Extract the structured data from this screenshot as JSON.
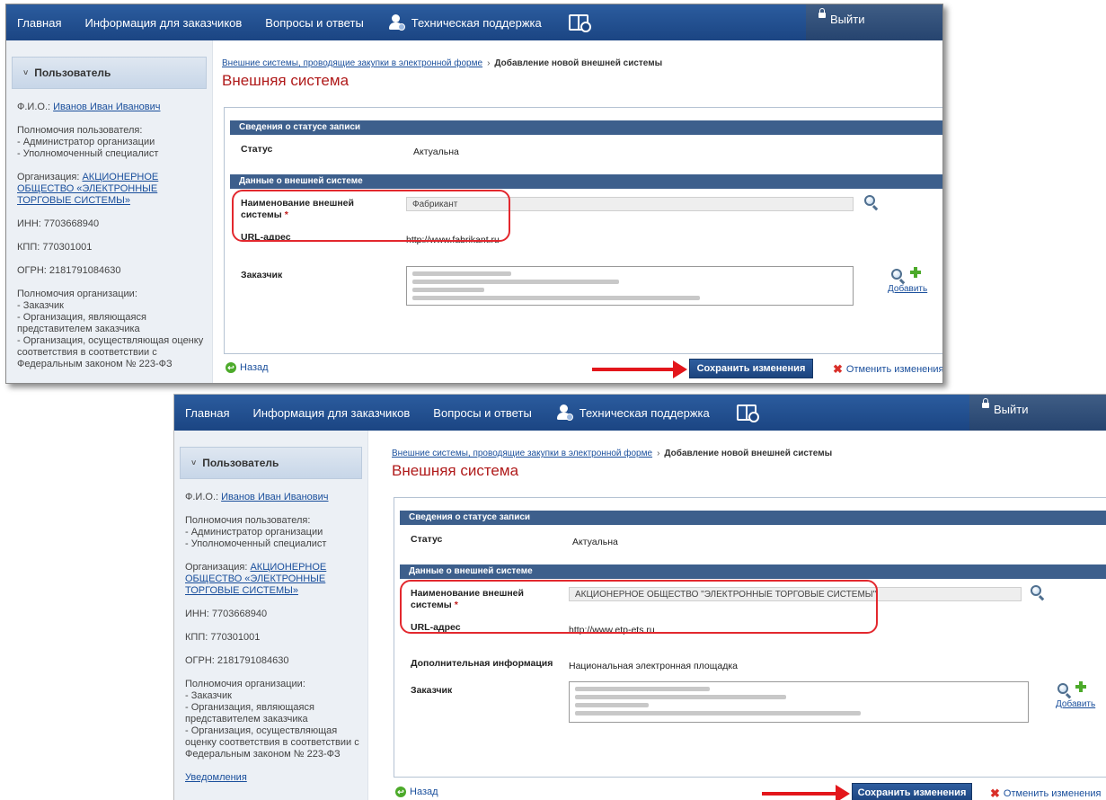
{
  "nav": {
    "home": "Главная",
    "customers_info": "Информация для заказчиков",
    "faq": "Вопросы и ответы",
    "support": "Техническая поддержка",
    "logout": "Выйти"
  },
  "sidebar": {
    "header": "Пользователь",
    "fio_label": "Ф.И.О.:",
    "fio_value": "Иванов Иван Иванович",
    "user_powers_label": "Полномочия пользователя:",
    "user_powers": [
      "- Администратор организации",
      "- Уполномоченный специалист"
    ],
    "org_label": "Организация:",
    "org_value": "АКЦИОНЕРНОЕ ОБЩЕСТВО «ЭЛЕКТРОННЫЕ ТОРГОВЫЕ СИСТЕМЫ»",
    "inn": "ИНН: 7703668940",
    "kpp": "КПП: 770301001",
    "ogrn": "ОГРН: 2181791084630",
    "org_powers_label": "Полномочия организации:",
    "org_powers": [
      "- Заказчик",
      "- Организация, являющаяся представителем заказчика",
      "- Организация, осуществляющая оценку соответствия в соответствии с Федеральным законом № 223-ФЗ"
    ],
    "notifications": "Уведомления"
  },
  "breadcrumb": {
    "parent": "Внешние системы, проводящие закупки в электронной форме",
    "separator": "›",
    "current": "Добавление новой внешней системы"
  },
  "page_title": "Внешняя система",
  "sections": {
    "status": "Сведения о статусе записи",
    "external": "Данные о внешней системе"
  },
  "labels": {
    "status": "Статус",
    "name_line1": "Наименование внешней",
    "name_line2": "системы",
    "required": "*",
    "url": "URL-адрес",
    "additional": "Дополнительная информация",
    "customer": "Заказчик",
    "add": "Добавить"
  },
  "record1": {
    "status": "Актуальна",
    "name": "Фабрикант",
    "url": "http://www.fabrikant.ru"
  },
  "record2": {
    "status": "Актуальна",
    "name": "АКЦИОНЕРНОЕ ОБЩЕСТВО \"ЭЛЕКТРОННЫЕ ТОРГОВЫЕ СИСТЕМЫ\"",
    "url": "http://www.etp-ets.ru",
    "additional": "Национальная электронная площадка"
  },
  "actions": {
    "back": "Назад",
    "save": "Сохранить изменения",
    "cancel": "Отменить изменения"
  },
  "colors": {
    "nav_bg": "#1b4583",
    "section_bg": "#3d5f8c",
    "title_red": "#b01b1b",
    "annotation_red": "#e3161b"
  }
}
